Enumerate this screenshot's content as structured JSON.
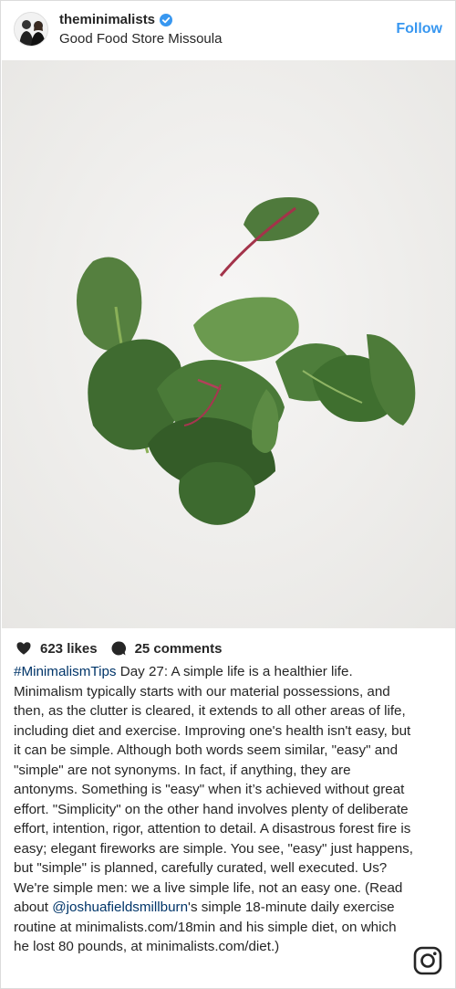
{
  "header": {
    "username": "theminimalists",
    "location": "Good Food Store Missoula",
    "follow_label": "Follow",
    "verified_color": "#3897f0"
  },
  "photo": {
    "subject": "spinach-leaves-icon"
  },
  "stats": {
    "likes": "623 likes",
    "comments": "25 comments"
  },
  "caption": {
    "hashtag": "#MinimalismTips",
    "part1": " Day 27: A simple life is a healthier life. Minimalism typically starts with our material possessions, and then, as the clutter is cleared, it extends to all other areas of life, including diet and exercise. Improving one's health isn't easy, but it can be simple. Although both words seem similar, \"easy\" and \"simple\" are not synonyms. In fact, if anything, they are antonyms. Something is \"easy\" when it’s achieved without great effort. \"Simplicity\" on the other hand involves plenty of deliberate effort, intention, rigor, attention to detail. A disastrous forest fire is easy; elegant fireworks are simple. You see, \"easy\" just happens, but \"simple\" is planned, carefully curated, well executed. Us? We're simple men: we a live simple life, not an easy one. (Read about ",
    "mention": "@joshuafieldsmillburn",
    "part2": "'s simple 18-minute daily exercise routine at minimalists.com/18min and his simple diet, on which he lost 80 pounds, at minimalists.com/diet.)"
  },
  "colors": {
    "link": "#003569",
    "accent": "#3897f0",
    "text": "#262626"
  }
}
